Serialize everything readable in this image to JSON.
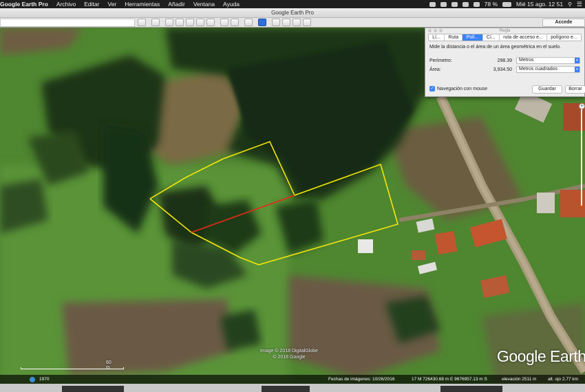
{
  "menubar": {
    "app_name": "Google Earth Pro",
    "items": [
      "Archivo",
      "Editar",
      "Ver",
      "Herramientas",
      "Añadir",
      "Ventana",
      "Ayuda"
    ],
    "battery": "78 %",
    "clock": "Mié 15 ago.  12 51"
  },
  "window": {
    "title": "Google Earth Pro"
  },
  "toolbar": {
    "sign_in_label": "Accede"
  },
  "ruler": {
    "title": "Regla",
    "tabs": [
      "Lí...",
      "Ruta",
      "Polí...",
      "Cí...",
      "ruta de acceso e...",
      "polígono e..."
    ],
    "active_tab_index": 2,
    "description": "Mide la distancia o el área de un área geométrica en el suelo.",
    "perimeter_label": "Perímetro:",
    "perimeter_value": "298.39",
    "perimeter_unit": "Metros",
    "area_label": "Área:",
    "area_value": "3,934.50",
    "area_unit": "Metros cuadrados",
    "mouse_nav_label": "Navegación con mouse",
    "mouse_nav_checked": true,
    "save_label": "Guardar",
    "clear_label": "Borrar"
  },
  "map": {
    "image_credit_line1": "Image © 2018 DigitalGlobe",
    "image_credit_line2": "© 2018 Google",
    "scale_label": "60 m",
    "logo": "Google Earth",
    "polygon_color": "#f5e60a",
    "selected_edge_color": "#e01b1b"
  },
  "status": {
    "history_year": "1970",
    "imagery_date": "Fechas de imágenes: 10/26/2016",
    "coordinates": "17 M 726430.68 m E 9676957.13 m S",
    "elevation": "elevación  2511 m",
    "eye_alt": "alt. ojo  2.77 km"
  }
}
